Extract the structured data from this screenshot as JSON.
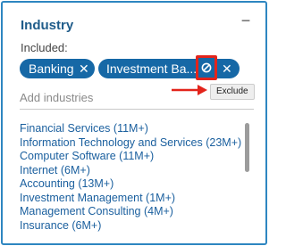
{
  "header": {
    "title": "Industry",
    "collapse_symbol": "−"
  },
  "included": {
    "label": "Included:",
    "chips": [
      {
        "label": "Banking",
        "remove_symbol": "✕"
      },
      {
        "label": "Investment Ba...",
        "remove_symbol": "✕",
        "exclude_icon": "block-icon"
      }
    ]
  },
  "search": {
    "placeholder": "Add industries"
  },
  "tooltip": {
    "text": "Exclude"
  },
  "industries": [
    "Financial Services (11M+)",
    "Information Technology and Services (23M+)",
    "Computer Software (11M+)",
    "Internet (6M+)",
    "Accounting (13M+)",
    "Investment Management (1M+)",
    "Management Consulting (4M+)",
    "Insurance (6M+)"
  ],
  "colors": {
    "panel_border": "#2e86c1",
    "chip_bg": "#1668a6",
    "highlight": "#e3241b",
    "link": "#1a5f9e"
  }
}
